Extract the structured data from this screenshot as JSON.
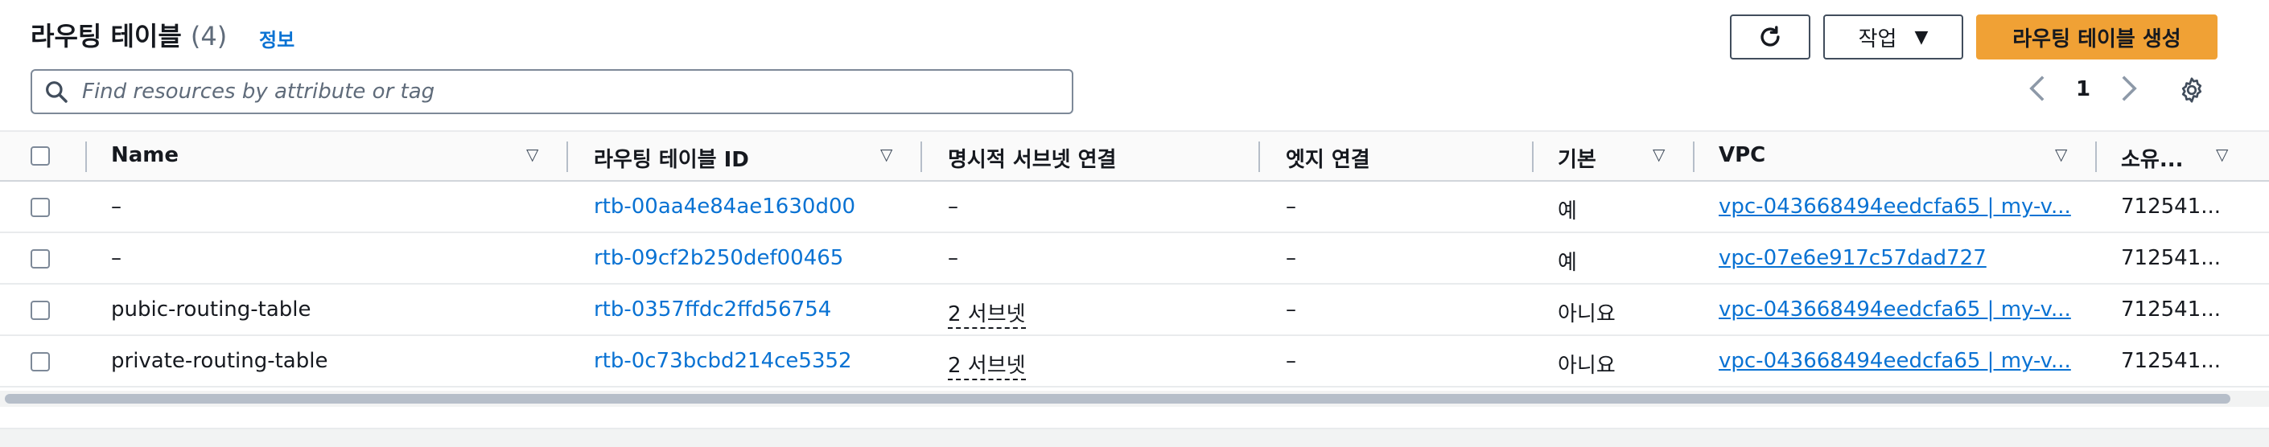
{
  "header": {
    "title": "라우팅 테이블",
    "count": "(4)",
    "info_link": "정보",
    "actions_label": "작업",
    "create_label": "라우팅 테이블 생성"
  },
  "search": {
    "placeholder": "Find resources by attribute or tag"
  },
  "pagination": {
    "current_page": "1"
  },
  "table": {
    "columns": {
      "name": "Name",
      "route_table_id": "라우팅 테이블 ID",
      "explicit_subnet": "명시적 서브넷 연결",
      "edge": "엣지 연결",
      "main": "기본",
      "vpc": "VPC",
      "owner": "소유..."
    },
    "rows": [
      {
        "name": "–",
        "id": "rtb-00aa4e84ae1630d00",
        "subnet": "–",
        "edge": "–",
        "main": "예",
        "vpc": "vpc-043668494eedcfa65 | my-v...",
        "owner": "712541..."
      },
      {
        "name": "–",
        "id": "rtb-09cf2b250def00465",
        "subnet": "–",
        "edge": "–",
        "main": "예",
        "vpc": "vpc-07e6e917c57dad727",
        "owner": "712541..."
      },
      {
        "name": "pubic-routing-table",
        "id": "rtb-0357ffdc2ffd56754",
        "subnet": "2 서브넷",
        "edge": "–",
        "main": "아니요",
        "vpc": "vpc-043668494eedcfa65 | my-v...",
        "owner": "712541..."
      },
      {
        "name": "private-routing-table",
        "id": "rtb-0c73bcbd214ce5352",
        "subnet": "2 서브넷",
        "edge": "–",
        "main": "아니요",
        "vpc": "vpc-043668494eedcfa65 | my-v...",
        "owner": "712541..."
      }
    ]
  },
  "icons": {
    "refresh": "refresh-icon",
    "caret": "caret-down-icon",
    "search": "search-icon",
    "prev": "chevron-left-icon",
    "next": "chevron-right-icon",
    "settings": "gear-icon"
  },
  "colors": {
    "primary_button": "#f0a135",
    "link": "#0972d3"
  }
}
